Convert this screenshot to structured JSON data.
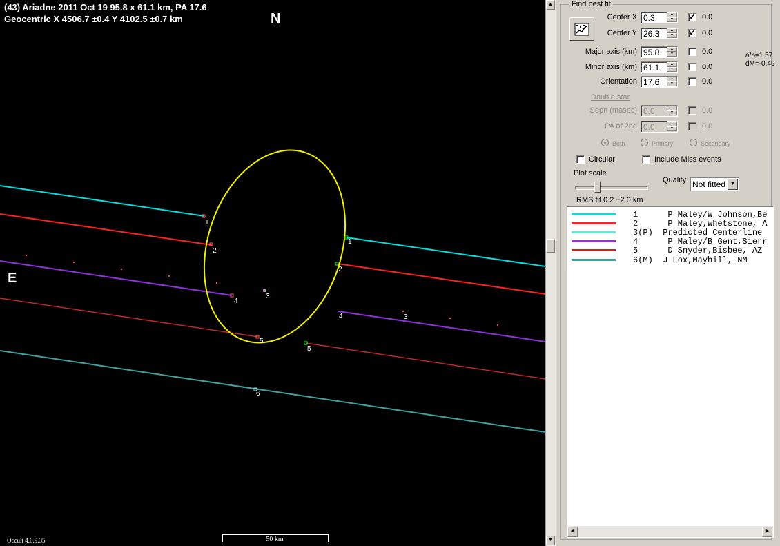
{
  "plot": {
    "title_line1": "(43) Ariadne  2011 Oct 19   95.8 x 61.1 km, PA 17.6",
    "title_line2": "Geocentric  X  4506.7 ±0.4   Y 4102.5 ±0.7 km",
    "north_label": "N",
    "east_label": "E",
    "version": "Occult 4.0.9.35",
    "scale_label": "50 km",
    "colors": {
      "background": "#000000",
      "ellipse": "#f0f000",
      "chord1": "#00e0e0",
      "chord2": "#ff2020",
      "chord4": "#9030e0",
      "chord5": "#c02828",
      "chord6": "#40a0a0"
    },
    "chord_labels": [
      "1",
      "2",
      "3",
      "4",
      "5",
      "6"
    ]
  },
  "panel": {
    "group_title": "Find best fit",
    "fit_button_icon": "fit-chart-icon",
    "center_x": {
      "label": "Center X",
      "value": "0.3",
      "checked": true,
      "offset": "0.0"
    },
    "center_y": {
      "label": "Center Y",
      "value": "26.3",
      "checked": true,
      "offset": "0.0"
    },
    "major_axis": {
      "label": "Major axis (km)",
      "value": "95.8",
      "checked": false,
      "offset": "0.0"
    },
    "minor_axis": {
      "label": "Minor axis (km)",
      "value": "61.1",
      "checked": false,
      "offset": "0.0"
    },
    "orientation": {
      "label": "Orientation",
      "value": "17.6",
      "checked": false,
      "offset": "0.0"
    },
    "ratio_ab": "a/b=1.57",
    "delta_m": "dM=-0.49",
    "double_star_link": "Double star",
    "sepn": {
      "label": "Sepn (masec)",
      "value": "0.0",
      "offset": "0.0"
    },
    "pa2": {
      "label": "PA of 2nd",
      "value": "0.0",
      "offset": "0.0"
    },
    "radios": [
      "Both",
      "Primary",
      "Secondary"
    ],
    "circular_label": "Circular",
    "include_miss_label": "Include Miss events",
    "plot_scale_label": "Plot scale",
    "quality_label": "Quality",
    "quality_value": "Not fitted",
    "rms_fit": "RMS fit 0.2 ±2.0 km",
    "observers": [
      {
        "color": "#00e0e0",
        "text": "1      P Maley/W Johnson,Be"
      },
      {
        "color": "#ff2020",
        "text": "2      P Maley,Whetstone, A"
      },
      {
        "color": "#60f0d0",
        "text": "3(P)  Predicted Centerline"
      },
      {
        "color": "#9030e0",
        "text": "4      P Maley/B Gent,Sierr"
      },
      {
        "color": "#c02828",
        "text": "5      D Snyder,Bisbee, AZ"
      },
      {
        "color": "#40a0a0",
        "text": "6(M)  J Fox,Mayhill, NM"
      }
    ]
  }
}
